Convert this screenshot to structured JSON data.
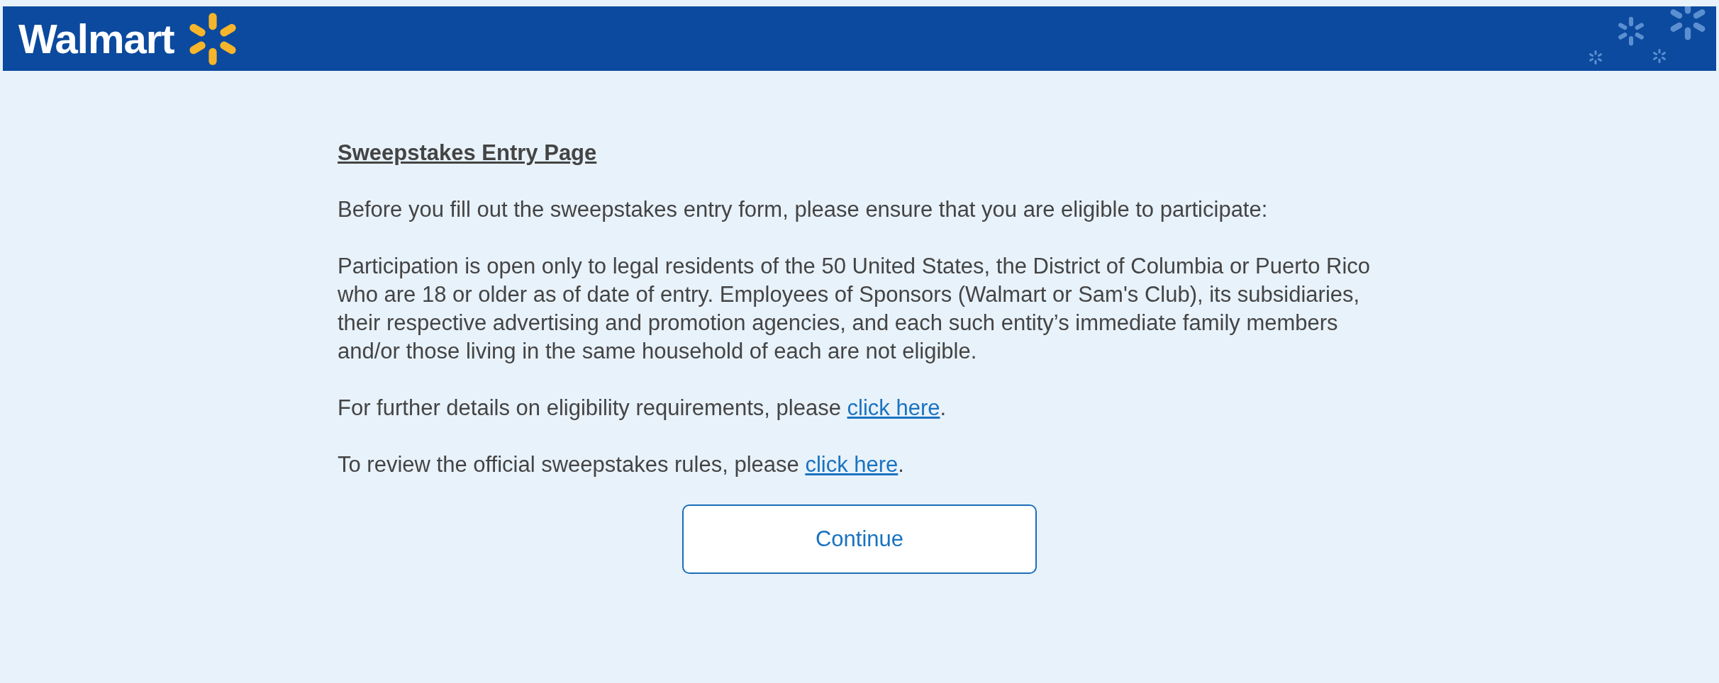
{
  "header": {
    "logo_text": "Walmart"
  },
  "title": "Sweepstakes Entry Page",
  "paragraphs": [
    {
      "text": "Before you fill out the sweepstakes entry form, please ensure that you are eligible to participate:"
    },
    {
      "text": "Participation is open only to legal residents of the 50 United States, the District of Columbia or Puerto Rico who are 18 or older as of date of entry. Employees of Sponsors (Walmart or Sam's Club), its subsidiaries, their respective advertising and promotion agencies, and each such entity’s immediate family members and/or those living in the same household of each are not eligible."
    },
    {
      "text": "For further details on eligibility requirements, please ",
      "link": "click here",
      "after": "."
    },
    {
      "text": "To review the official sweepstakes rules, please ",
      "link": "click here",
      "after": "."
    }
  ],
  "button": {
    "label": "Continue"
  }
}
